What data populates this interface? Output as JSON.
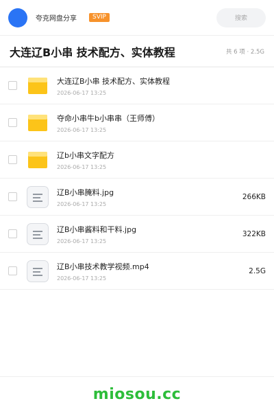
{
  "header": {
    "app_name": "夸克网盘分享",
    "vip_badge": "SVIP",
    "search_placeholder": "搜索",
    "accent_color": "#2a74f5",
    "vip_color": "#f7922b"
  },
  "share": {
    "title": "大连辽B小串 技术配方、实体教程",
    "summary": "共 6 项 · 2.5G"
  },
  "files": [
    {
      "type": "folder",
      "icon": "folder-icon",
      "name": "大连辽B小串 技术配方、实体教程",
      "date": "2026-06-17 13:25",
      "size": ""
    },
    {
      "type": "folder",
      "icon": "folder-icon",
      "name": "夺命小串牛b小串串（王师傅）",
      "date": "2026-06-17 13:25",
      "size": ""
    },
    {
      "type": "folder",
      "icon": "folder-icon",
      "name": "辽b小串文字配方",
      "date": "2026-06-17 13:25",
      "size": ""
    },
    {
      "type": "file",
      "icon": "document-icon",
      "name": "辽B小串腌料.jpg",
      "date": "2026-06-17 13:25",
      "size": "266KB"
    },
    {
      "type": "file",
      "icon": "document-icon",
      "name": "辽B小串酱料和干料.jpg",
      "date": "2026-06-17 13:25",
      "size": "322KB"
    },
    {
      "type": "file",
      "icon": "document-icon",
      "name": "辽B小串技术教学视频.mp4",
      "date": "2026-06-17 13:25",
      "size": "2.5G"
    }
  ],
  "footer": {
    "brand": "miosou.cc",
    "brand_color": "#2dbd3a"
  }
}
